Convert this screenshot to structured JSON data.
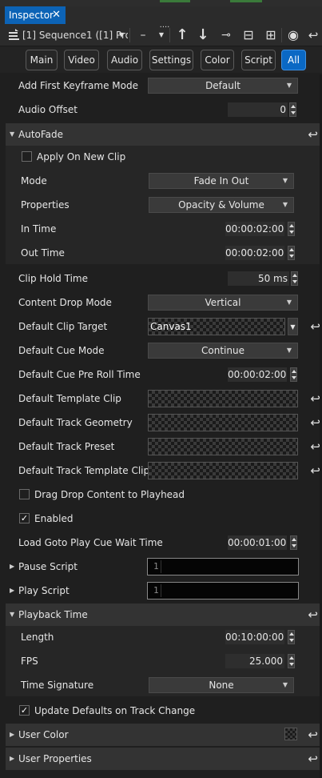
{
  "tab": {
    "title": "Inspector",
    "close": "✕"
  },
  "toolbar": {
    "menu_icon": "menu-sort-icon",
    "sequence": "[1] Sequence1 ([1] Pro",
    "minus": "–",
    "grip": "....",
    "up": "↑",
    "down": "↓",
    "pin": "⊸",
    "collapse": "⊟",
    "grid": "⊞",
    "eye": "◉",
    "undo": "↩"
  },
  "filters": [
    "Main",
    "Video",
    "Audio",
    "Settings",
    "Color",
    "Script",
    "All"
  ],
  "active_filter": "All",
  "props": {
    "add_first_keyframe_mode": {
      "label": "Add First Keyframe Mode",
      "value": "Default"
    },
    "audio_offset": {
      "label": "Audio Offset",
      "value": "0"
    },
    "autofade": {
      "title": "AutoFade",
      "apply_on_new_clip": {
        "label": "Apply On New Clip",
        "checked": false
      },
      "mode": {
        "label": "Mode",
        "value": "Fade In Out"
      },
      "properties": {
        "label": "Properties",
        "value": "Opacity & Volume"
      },
      "in_time": {
        "label": "In Time",
        "value": "00:00:02:00"
      },
      "out_time": {
        "label": "Out Time",
        "value": "00:00:02:00"
      }
    },
    "clip_hold_time": {
      "label": "Clip Hold Time",
      "value": "50 ms"
    },
    "content_drop_mode": {
      "label": "Content Drop Mode",
      "value": "Vertical"
    },
    "default_clip_target": {
      "label": "Default Clip Target",
      "value": "Canvas1"
    },
    "default_cue_mode": {
      "label": "Default Cue Mode",
      "value": "Continue"
    },
    "default_cue_pre_roll_time": {
      "label": "Default Cue Pre Roll Time",
      "value": "00:00:02:00"
    },
    "default_template_clip": {
      "label": "Default Template Clip"
    },
    "default_track_geometry": {
      "label": "Default Track Geometry"
    },
    "default_track_preset": {
      "label": "Default Track Preset"
    },
    "default_track_template_clip": {
      "label": "Default Track Template Clip"
    },
    "drag_drop": {
      "label": "Drag Drop Content to Playhead",
      "checked": false
    },
    "enabled": {
      "label": "Enabled",
      "checked": true
    },
    "load_goto": {
      "label": "Load Goto Play Cue Wait Time",
      "value": "00:00:01:00"
    },
    "pause_script": {
      "label": "Pause Script",
      "line": "1"
    },
    "play_script": {
      "label": "Play Script",
      "line": "1"
    },
    "playback_time": {
      "title": "Playback Time",
      "length": {
        "label": "Length",
        "value": "00:10:00:00"
      },
      "fps": {
        "label": "FPS",
        "value": "25.000"
      },
      "time_signature": {
        "label": "Time Signature",
        "value": "None"
      }
    },
    "update_defaults": {
      "label": "Update Defaults on Track Change",
      "checked": true
    },
    "user_color": {
      "title": "User Color"
    },
    "user_properties": {
      "title": "User Properties"
    }
  },
  "glyphs": {
    "dropdown": "▼",
    "expanded": "▼",
    "collapsed": "▶",
    "reset": "↩",
    "check": "✓"
  },
  "colors": {
    "accent": "#0a68c4",
    "tab": "#0c63b6",
    "background": "#1f1f1f",
    "section": "#333333"
  }
}
